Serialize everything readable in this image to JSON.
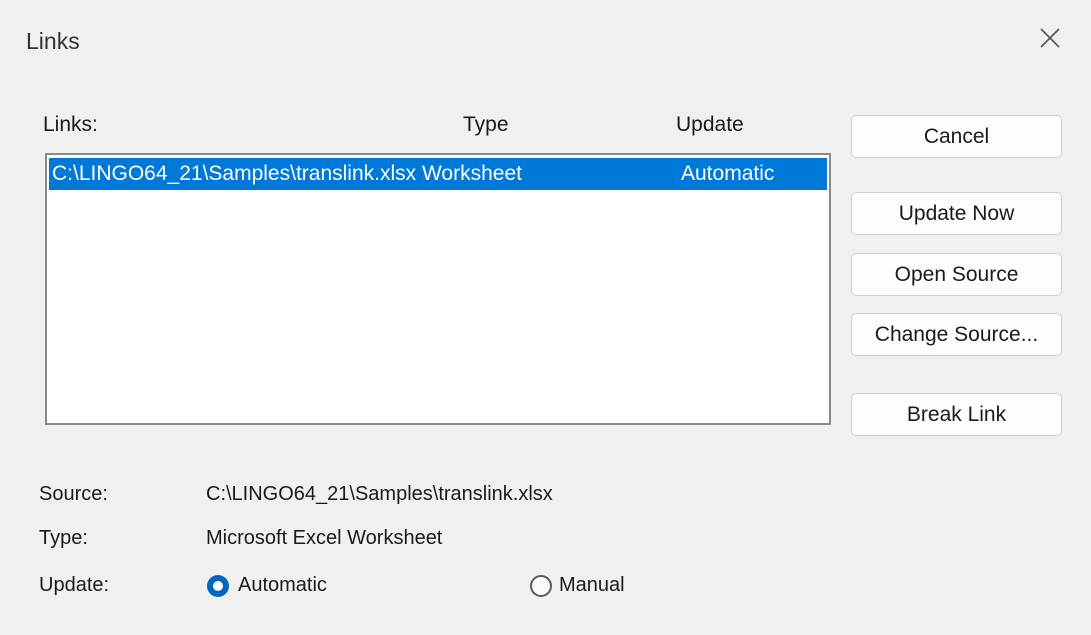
{
  "dialog": {
    "title": "Links",
    "close_icon": "close-icon"
  },
  "list": {
    "headers": {
      "links": "Links:",
      "type": "Type",
      "update": "Update"
    },
    "rows": [
      {
        "name": "C:\\LINGO64_21\\Samples\\translink.xlsx Worksheet",
        "update": "Automatic",
        "selected": true
      }
    ]
  },
  "buttons": {
    "cancel": "Cancel",
    "update_now": "Update Now",
    "open_source": "Open Source",
    "change_source": "Change Source...",
    "break_link": "Break Link"
  },
  "details": {
    "source_label": "Source:",
    "source_value": "C:\\LINGO64_21\\Samples\\translink.xlsx",
    "type_label": "Type:",
    "type_value": "Microsoft Excel Worksheet",
    "update_label": "Update:",
    "automatic_label": "Automatic",
    "manual_label": "Manual",
    "selected_update": "Automatic"
  },
  "colors": {
    "selection": "#0078d7",
    "radio_accent": "#0067c0"
  }
}
